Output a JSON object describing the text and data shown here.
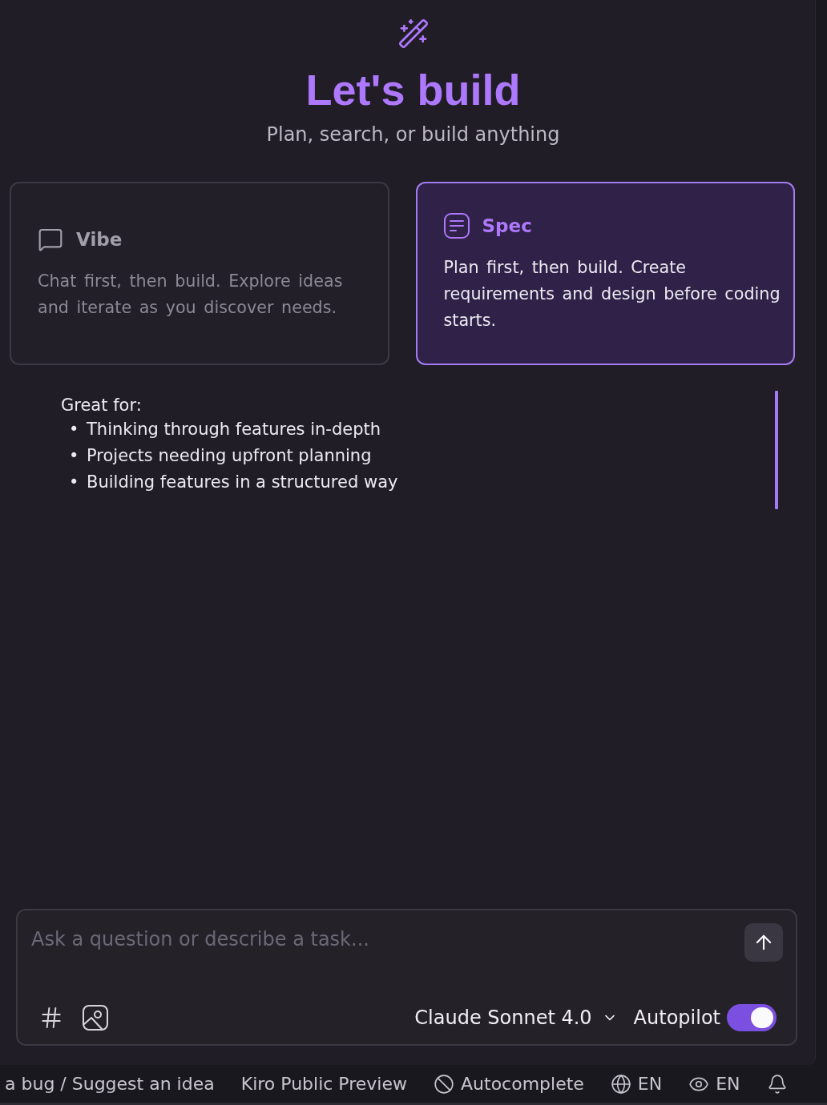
{
  "header": {
    "title": "Let's build",
    "subtitle": "Plan, search, or build anything"
  },
  "modes": [
    {
      "kind": "chat",
      "title": "Vibe",
      "description": "Chat first, then build. Explore ideas and iterate as you discover needs.",
      "selected": false
    },
    {
      "kind": "spec",
      "title": "Spec",
      "description": "Plan first, then build. Create requirements and design before coding starts.",
      "selected": true
    }
  ],
  "great_for": {
    "heading": "Great for:",
    "items": [
      {
        "marker": "•",
        "text": "Thinking through features in-depth"
      },
      {
        "marker": "•",
        "text": "Projects needing upfront planning"
      },
      {
        "marker": "•",
        "text": "Building features in a structured way"
      }
    ]
  },
  "composer": {
    "placeholder": "Ask a question or describe a task...",
    "model": "Claude Sonnet 4.0",
    "autopilot": {
      "label": "Autopilot",
      "on": true
    }
  },
  "status_bar": {
    "items": [
      {
        "kind": "text",
        "label": "a bug / Suggest an idea"
      },
      {
        "kind": "text",
        "label": "Kiro Public Preview"
      },
      {
        "kind": "autocomplete",
        "label": "Autocomplete"
      },
      {
        "kind": "language",
        "label": "EN"
      },
      {
        "kind": "eye",
        "label": "EN"
      },
      {
        "kind": "bell"
      }
    ]
  }
}
